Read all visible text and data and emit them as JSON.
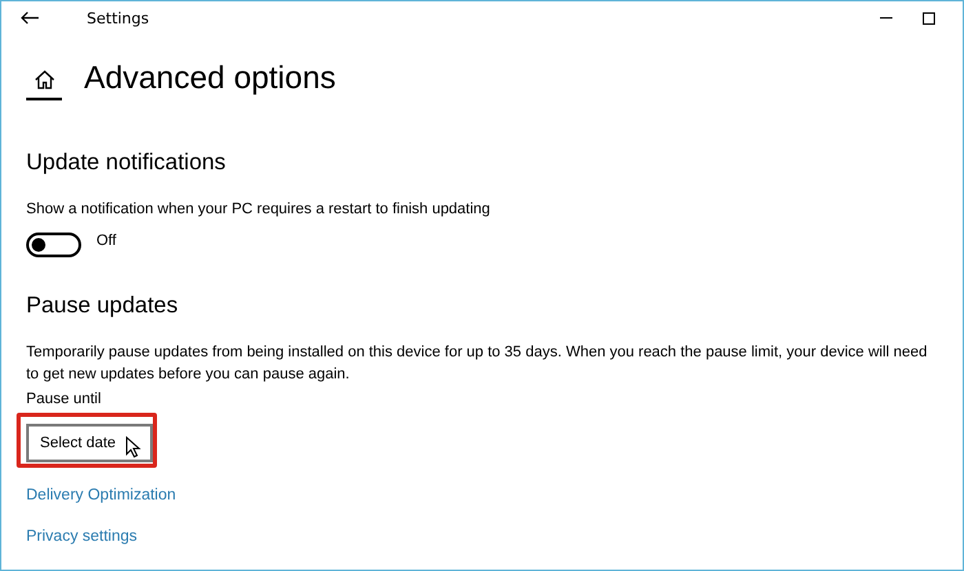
{
  "window": {
    "title": "Settings"
  },
  "page_title": "Advanced options",
  "update_notifications": {
    "heading": "Update notifications",
    "description": "Show a notification when your PC requires a restart to finish updating",
    "toggle": {
      "on": false,
      "label": "Off"
    }
  },
  "pause_updates": {
    "heading": "Pause updates",
    "description": "Temporarily pause updates from being installed on this device for up to 35 days. When you reach the pause limit, your device will need to get new updates before you can pause again.",
    "field_label": "Pause until",
    "dropdown": {
      "value": "Select date",
      "highlighted": true
    }
  },
  "links": [
    "Delivery Optimization",
    "Privacy settings"
  ]
}
